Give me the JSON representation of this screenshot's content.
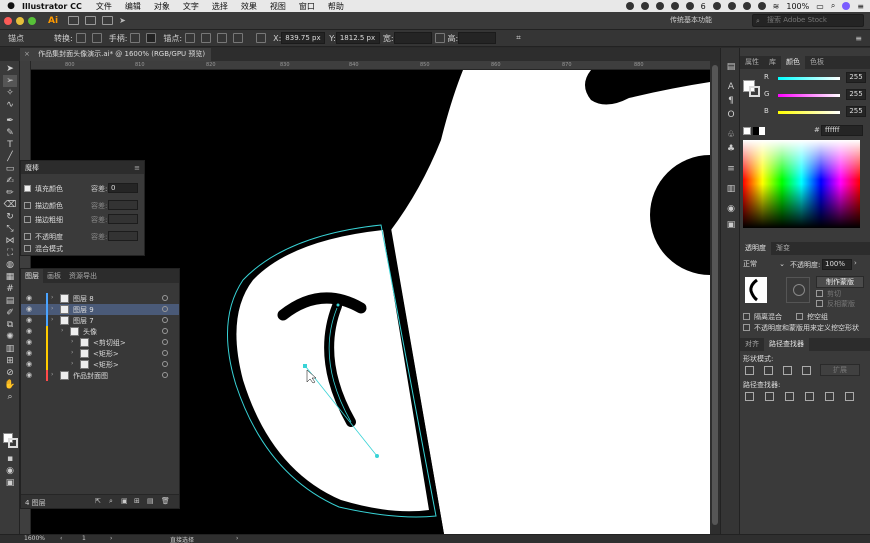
{
  "menubar": {
    "app_name": "Illustrator CC",
    "menus": [
      "文件",
      "编辑",
      "对象",
      "文字",
      "选择",
      "效果",
      "视图",
      "窗口",
      "帮助"
    ],
    "battery": "100%",
    "notifications": "6"
  },
  "appbar": {
    "workspace": "传统基本功能",
    "search_placeholder": "搜索 Adobe Stock"
  },
  "controlbar": {
    "tool_label": "锚点",
    "convert_label": "转换:",
    "handle_label": "手柄:",
    "anchor_label": "锚点:",
    "x_label": "X:",
    "x_value": "839.75 px",
    "y_label": "Y:",
    "y_value": "1812.5 px",
    "w_label": "宽:",
    "h_label": "高:"
  },
  "document": {
    "tab_title": "作品集封面头像演示.ai* @ 1600% (RGB/GPU 预览)"
  },
  "ruler_labels": [
    "800",
    "810",
    "820",
    "830",
    "840",
    "850",
    "860",
    "870",
    "880"
  ],
  "magic_wand": {
    "title": "魔棒",
    "fill_color": "填充颜色",
    "stroke_color": "描边颜色",
    "stroke_weight": "描边粗细",
    "opacity": "不透明度",
    "blend_mode": "混合模式",
    "tolerance_label": "容差:",
    "tolerance_value": "0"
  },
  "layers_panel": {
    "tabs": [
      "图层",
      "画板",
      "资源导出"
    ],
    "rows": [
      {
        "name": "图层 8",
        "indent": 1,
        "color": "#4aa3ff"
      },
      {
        "name": "图层 9",
        "indent": 1,
        "color": "#4aa3ff",
        "selected": true
      },
      {
        "name": "图层 7",
        "indent": 1,
        "color": "#4aa3ff"
      },
      {
        "name": "头像",
        "indent": 2,
        "color": "#ffcc00"
      },
      {
        "name": "<剪切组>",
        "indent": 3,
        "color": "#ffcc00"
      },
      {
        "name": "<矩形>",
        "indent": 3,
        "color": "#ffcc00"
      },
      {
        "name": "<矩形>",
        "indent": 3,
        "color": "#ffcc00"
      },
      {
        "name": "作品封面图",
        "indent": 1,
        "color": "#ff4a4a"
      }
    ],
    "footer": "4 图层"
  },
  "color_panel": {
    "tabs": [
      "属性",
      "库",
      "颜色",
      "色板"
    ],
    "channels": [
      {
        "label": "R",
        "value": "255",
        "color": "#ff3030"
      },
      {
        "label": "G",
        "value": "255",
        "color": "#ff30ff"
      },
      {
        "label": "B",
        "value": "255",
        "color": "#ffe030"
      }
    ],
    "hex_label": "#",
    "hex_value": "ffffff"
  },
  "transparency_panel": {
    "tabs": [
      "透明度",
      "渐变"
    ],
    "blend_mode": "正常",
    "opacity_label": "不透明度:",
    "opacity_value": "100%",
    "make_mask": "制作蒙版",
    "clip": "剪切",
    "invert_mask": "反相蒙版",
    "isolate_blending": "隔离混合",
    "knockout_group": "挖空组",
    "opacity_define_knockout": "不透明度和蒙版用来定义挖空形状"
  },
  "pathfinder_panel": {
    "tabs": [
      "对齐",
      "路径查找器"
    ],
    "shape_modes": "形状模式:",
    "expand": "扩展",
    "pathfinders": "路径查找器:"
  },
  "status": {
    "zoom": "1600%",
    "artboard": "1",
    "mode": "直接选择"
  }
}
